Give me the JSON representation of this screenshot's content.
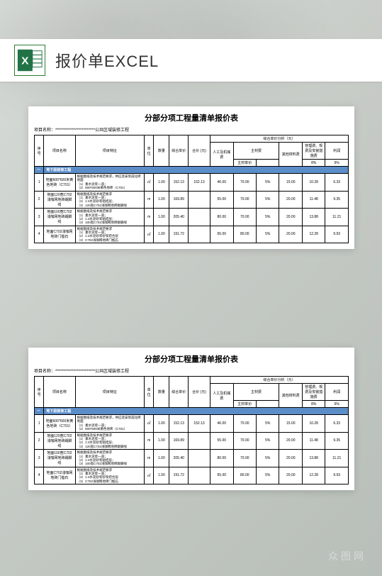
{
  "header": {
    "title": "报价单EXCEL",
    "icon": "excel-icon"
  },
  "watermark": "众图网",
  "sheet": {
    "title": "分部分项工程量清单报价表",
    "project_label": "项目名称：",
    "project_name": "************************公共区域装修工程",
    "columns": {
      "seq": "序号",
      "name": "项目名称",
      "feature": "项目特征",
      "unit": "单位",
      "qty": "数量",
      "unit_price": "综合单价",
      "total": "合价 (元)",
      "analysis_group": "综合单价分析（元）",
      "labor": "人工及机械费",
      "main_mat": "主材费",
      "other_mat": "其他材料费",
      "mgmt": "管理费、规费及安装措施费",
      "profit": "利润",
      "main_mat_sub": "主材单价",
      "rate8": "8%",
      "rate6": "6%"
    },
    "section": {
      "num": "一",
      "title": "地下层装饰工程"
    },
    "rows": [
      {
        "seq": "1",
        "name": "地面600*600米黄色地砖（C701）",
        "feature": "根据图纸及技术规范要求，供应及安装成化砖地面\\n（1）素水泥浆一道；\\n（2）600*600米黄色地砖（C701）",
        "unit": "㎡",
        "qty": "1.00",
        "unit_price": "152.13",
        "total": "152.13",
        "labor": "46.00",
        "main_mat": "70.00",
        "main_mat_rate": "5%",
        "other_mat": "15.00",
        "mgmt": "10.28",
        "profit": "6.33"
      },
      {
        "seq": "2",
        "name": "地面120宽C702浅咖网地砖踢脚线",
        "feature": "根据图纸及技术规范要求\\n（1）素水泥浆一道；\\n（2）1:4水泥砂浆粘结层；\\n（3）120宽C702浅咖网地砖踢脚线",
        "unit": "m",
        "qty": "1.00",
        "unit_price": "169.89",
        "total": "",
        "labor": "55.00",
        "main_mat": "70.00",
        "main_mat_rate": "5%",
        "other_mat": "20.00",
        "mgmt": "11.48",
        "profit": "9.35"
      },
      {
        "seq": "3",
        "name": "地面100宽C702浅咖网地砖踢脚线",
        "feature": "根据图纸及技术规范要求\\n（1）素水泥浆一道；\\n（2）1:4水泥砂浆粘结层；\\n（3）100宽C702浅咖网地砖踢脚线",
        "unit": "m",
        "qty": "1.00",
        "unit_price": "205.40",
        "total": "",
        "labor": "80.00",
        "main_mat": "70.00",
        "main_mat_rate": "5%",
        "other_mat": "20.00",
        "mgmt": "13.88",
        "profit": "11.21"
      },
      {
        "seq": "4",
        "name": "地面C702浅咖网地砖门槛石",
        "feature": "根据图纸及技术规范要求\\n（1）素水泥浆一道；\\n（2）1:4水泥砂浆砂浆结合层\\n（3）C702浅咖网地砖门槛石",
        "unit": "㎡",
        "qty": "1.00",
        "unit_price": "191.72",
        "total": "",
        "labor": "65.00",
        "main_mat": "80.00",
        "main_mat_rate": "5%",
        "other_mat": "20.00",
        "mgmt": "12.28",
        "profit": "9.93"
      }
    ]
  }
}
